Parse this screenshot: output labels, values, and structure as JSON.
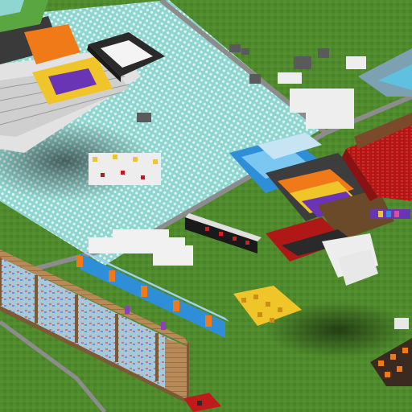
{
  "scene": {
    "view": "isometric-voxel-world",
    "palette": {
      "grass": "#4f8a2c",
      "grass_dark": "#3f7422",
      "road": "#8c8c8c",
      "road_edge": "#6f6f6f",
      "plaza": "#8fd6d0",
      "plaza_grid": "#d9f2ef",
      "wood": "#b88a57",
      "wood_dark": "#7b5a34",
      "quartz": "#e9e9e9",
      "redstone": "#c01b1b",
      "gold": "#f0c52a",
      "lapis": "#2e8fd8",
      "purple": "#6a35b5",
      "orange": "#f07a18",
      "coal": "#2a2a2a",
      "glass": "#cfe7f7"
    }
  }
}
